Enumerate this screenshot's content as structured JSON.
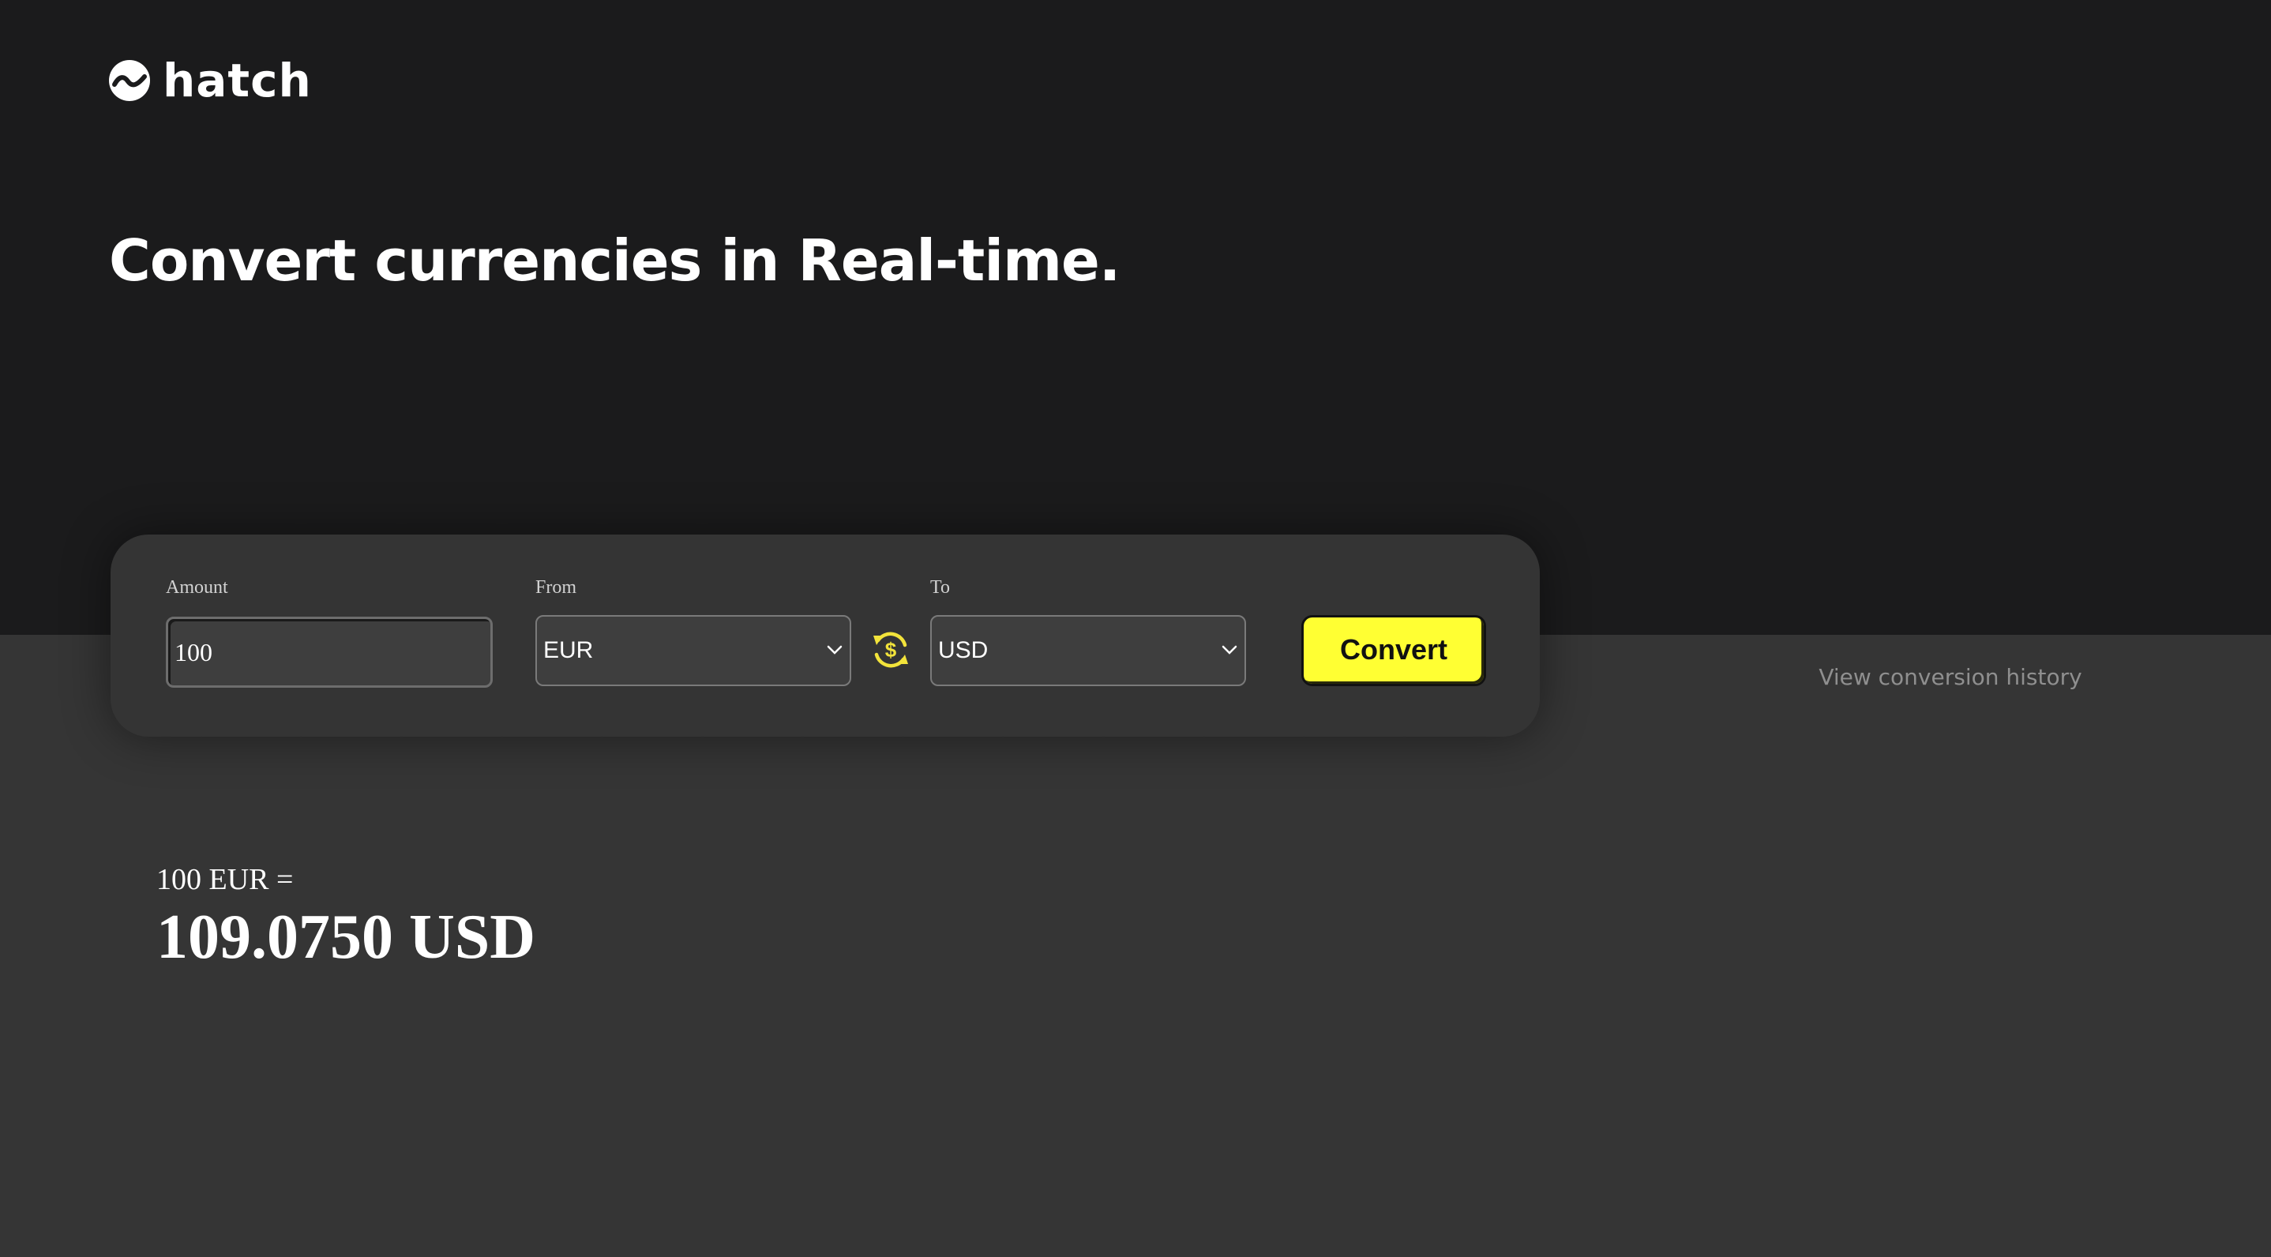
{
  "brand": {
    "name": "hatch",
    "logo_icon": "hatch-wave-logo-icon"
  },
  "hero": {
    "headline": "Convert currencies in Real-time."
  },
  "converter": {
    "amount": {
      "label": "Amount",
      "value": "100"
    },
    "from": {
      "label": "From",
      "selected": "EUR"
    },
    "swap_icon": "currency-swap-icon",
    "to": {
      "label": "To",
      "selected": "USD"
    },
    "convert_label": "Convert"
  },
  "history_link": "View conversion history",
  "result": {
    "equation": "100 EUR =",
    "value": "109.0750 USD"
  },
  "colors": {
    "accent": "#ffff33",
    "header_background": "#1b1b1c",
    "page_background": "#353535",
    "card_background": "#343434",
    "swap_icon": "#f2e33b"
  }
}
